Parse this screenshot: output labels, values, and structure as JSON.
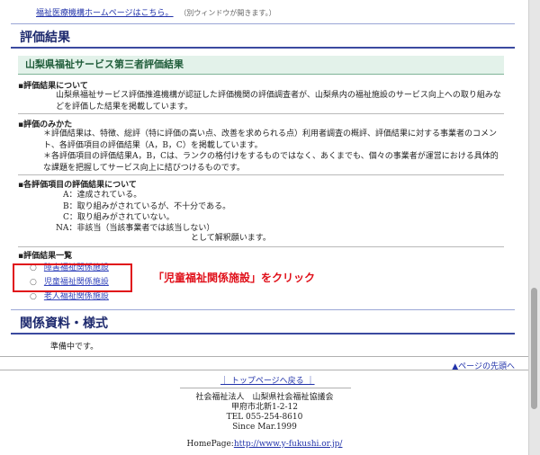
{
  "top": {
    "link_text": "福祉医療機構ホームページはこちら。",
    "note": "（別ウィンドウが開きます。）"
  },
  "section1": {
    "title": "評価結果"
  },
  "subhead": "山梨県福祉サービス第三者評価結果",
  "about": {
    "title": "▪評価結果について",
    "text": "山梨県福祉サービス評価推進機構が認証した評価機関の評価調査者が、山梨県内の福祉施設のサービス向上への取り組みなどを評価した結果を掲載しています。"
  },
  "howto": {
    "title": "▪評価のみかた",
    "bullet1": "＊評価結果は、特徴、総評（特に評価の高い点、改善を求められる点）利用者調査の概評、評価結果に対する事業者のコメント、各評価項目の評価結果（A，B，C）を掲載しています。",
    "bullet2": "＊各評価項目の評価結果A，B，Cは、ランクの格付けをするものではなく、あくまでも、個々の事業者が運営における具体的な課題を把握してサービス向上に結びつけるものです。"
  },
  "results": {
    "title": "▪各評価項目の評価結果について",
    "a": "A：達成されている。",
    "b": "B：取り組みがされているが、不十分である。",
    "c": "C：取り組みがされていない。",
    "na": "NA：非該当（当該事業者では該当しない）",
    "close": "として解釈願います。"
  },
  "list": {
    "title": "▪評価結果一覧",
    "items": [
      "障害福祉関係施設",
      "児童福祉関係施設",
      "老人福祉関係施設"
    ]
  },
  "callout": "「児童福祉関係施設」をクリック",
  "section2": {
    "title": "関係資料・様式"
  },
  "prep": "準備中です。",
  "page_top": "▲ページの先頭へ",
  "top_page_link": "｜ トップページへ戻る ｜",
  "footer": {
    "org": "社会福祉法人　山梨県社会福祉協議会",
    "address": "甲府市北新1-2-12",
    "tel": "TEL 055-254-8610",
    "since": "Since Mar.1999",
    "homepage_label": "HomePage:",
    "homepage_url": "http://www.y-fukushi.or.jp/"
  }
}
